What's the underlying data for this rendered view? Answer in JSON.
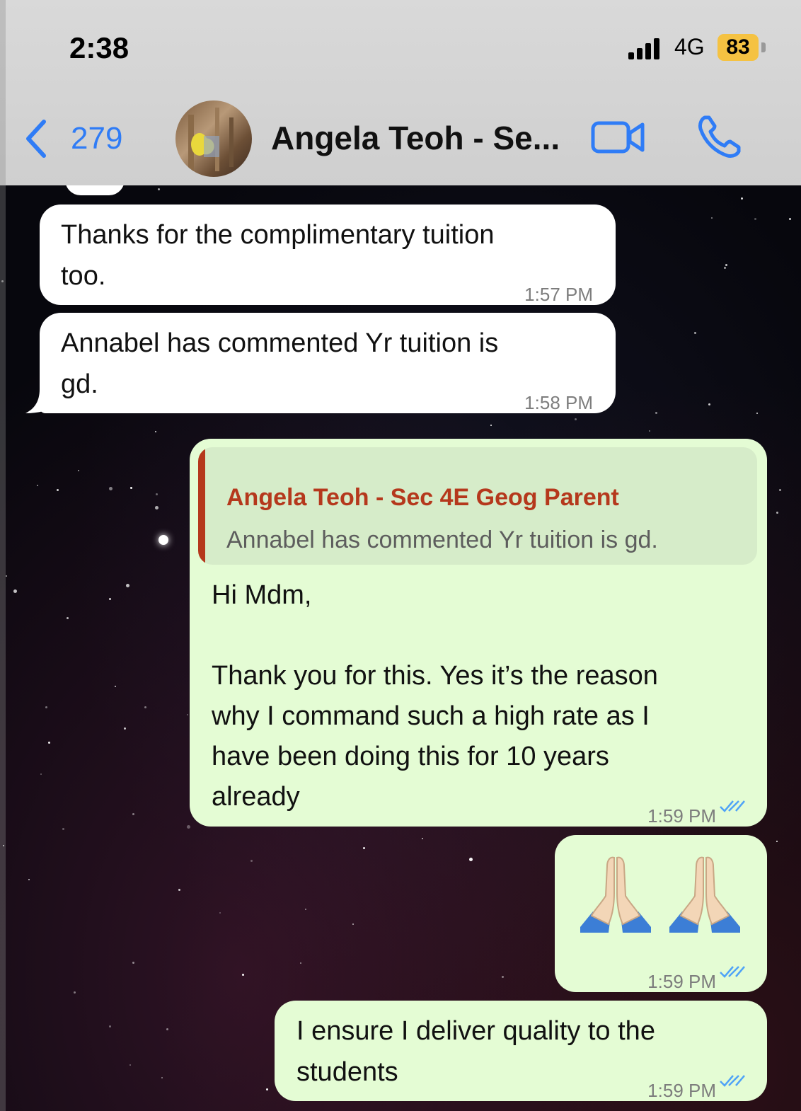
{
  "status_bar": {
    "time": "2:38",
    "network": "4G",
    "battery": "83"
  },
  "header": {
    "back_count": "279",
    "contact_name": "Angela Teoh - Se..."
  },
  "messages": [
    {
      "direction": "incoming",
      "lines": [
        "Thanks for the complimentary tuition",
        "too."
      ],
      "time": "1:57 PM"
    },
    {
      "direction": "incoming",
      "lines": [
        "Annabel has commented Yr tuition is",
        "gd."
      ],
      "time": "1:58 PM"
    },
    {
      "direction": "outgoing",
      "reply_to": {
        "author": "Angela Teoh - Sec 4E Geog Parent",
        "text": "Annabel has commented Yr tuition is gd."
      },
      "lines": [
        "Hi Mdm,",
        "",
        "Thank you for this. Yes it’s the reason",
        "why I command such a high rate as I",
        "have been doing this for 10 years",
        "already"
      ],
      "time": "1:59 PM",
      "read": true
    },
    {
      "direction": "outgoing",
      "emoji": [
        "folded-hands",
        "folded-hands"
      ],
      "time": "1:59 PM",
      "read": true
    },
    {
      "direction": "outgoing",
      "lines": [
        "I ensure I deliver quality to the",
        "students"
      ],
      "time": "1:59 PM",
      "read": true
    }
  ],
  "colors": {
    "accent_blue": "#2f7cf6",
    "outgoing_bubble": "#e4fcd4",
    "incoming_bubble": "#ffffff",
    "quote_author": "#b5381c",
    "read_ticks": "#4fa3f7",
    "battery": "#f5c242"
  }
}
